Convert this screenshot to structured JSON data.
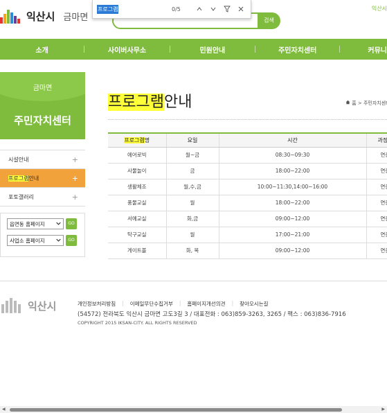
{
  "header": {
    "city": "익산시",
    "town": "금마면",
    "search_button": "검색",
    "top_right": "익산시"
  },
  "findbar": {
    "query": "프로그램",
    "count": "0/5",
    "prev_icon": "chevron-up-icon",
    "next_icon": "chevron-down-icon",
    "filter_icon": "filter-icon",
    "close_icon": "close-icon"
  },
  "nav": {
    "items": [
      "소개",
      "사이버사무소",
      "민원안내",
      "주민자치센터",
      "커뮤니"
    ]
  },
  "sidebar": {
    "town": "금마면",
    "title": "주민자치센터",
    "items": [
      {
        "label": "시설안내"
      },
      {
        "label_hl": "프로그램",
        "label_rest": "안내"
      },
      {
        "label": "포토갤러리"
      }
    ],
    "selects": [
      {
        "value": "읍면동 홈페이지",
        "go": "GO"
      },
      {
        "value": "사업소 홈페이지",
        "go": "GO"
      }
    ]
  },
  "main": {
    "title_hl": "프로그램",
    "title_rest": "안내",
    "breadcrumb": "홈 > 주민자치센터",
    "table": {
      "headers": {
        "program_hl": "프로그램",
        "program_rest": "명",
        "day": "요일",
        "time": "시간",
        "course": "과정"
      },
      "rows": [
        {
          "name": "에어로빅",
          "day": "월~금",
          "time": "08:30~09:30",
          "course": "연중"
        },
        {
          "name": "사물놀이",
          "day": "금",
          "time": "18:00~22:00",
          "course": "연중"
        },
        {
          "name": "생활체조",
          "day": "월,수,금",
          "time": "10:00~11:30,14:00~16:00",
          "course": "연중"
        },
        {
          "name": "풍물교실",
          "day": "월",
          "time": "18:00~22:00",
          "course": "연중"
        },
        {
          "name": "서예교실",
          "day": "화,금",
          "time": "09:00~12:00",
          "course": "연중"
        },
        {
          "name": "탁구교실",
          "day": "월",
          "time": "17:00~21:00",
          "course": "연중"
        },
        {
          "name": "게이트볼",
          "day": "화, 목",
          "time": "09:00~12:00",
          "course": "연중"
        }
      ]
    }
  },
  "footer": {
    "city": "익산시",
    "links": [
      "개인정보처리방침",
      "이메일무단수집거부",
      "홈페이지개선의견",
      "찾아오시는길"
    ],
    "address": "(54572) 전라북도 익산시 금마면 고도3길 3 / 대표전화 : 063)859-3263, 3265 / 팩스 : 063)836-7916",
    "copyright": "COPYRIGHT 2015 IKSAN-CITY. ALL RIGHTS RESERVED"
  },
  "colors": {
    "brand": "#7fbc3e",
    "active": "#f2a23a",
    "highlight": "#ffff3a"
  }
}
